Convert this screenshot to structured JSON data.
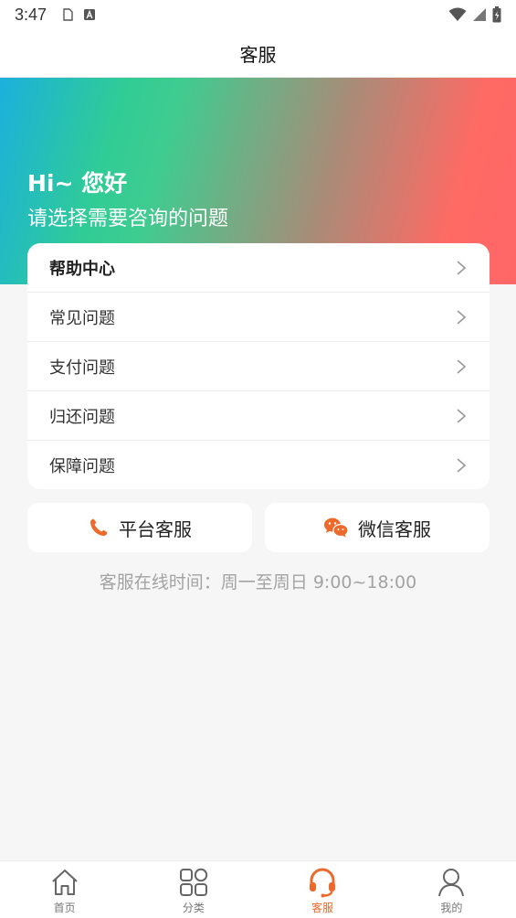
{
  "status_bar": {
    "time": "3:47"
  },
  "header": {
    "title": "客服"
  },
  "hero": {
    "greeting": "Hi~ 您好",
    "subtitle": "请选择需要咨询的问题"
  },
  "help_center": {
    "title": "帮助中心",
    "items": [
      {
        "label": "常见问题"
      },
      {
        "label": "支付问题"
      },
      {
        "label": "归还问题"
      },
      {
        "label": "保障问题"
      }
    ]
  },
  "contact": {
    "platform_label": "平台客服",
    "wechat_label": "微信客服"
  },
  "service_hours": "客服在线时间：周一至周日 9:00~18:00",
  "tabbar": {
    "active": "客服",
    "tabs": [
      {
        "label": "首页",
        "icon": "home-icon"
      },
      {
        "label": "分类",
        "icon": "category-icon"
      },
      {
        "label": "客服",
        "icon": "headset-icon"
      },
      {
        "label": "我的",
        "icon": "user-icon"
      }
    ]
  },
  "colors": {
    "accent": "#ee6a2c",
    "gradient_start": "#1bb0dd",
    "gradient_mid": "#3fcc90",
    "gradient_end": "#ff6767",
    "background": "#f6f6f6"
  }
}
